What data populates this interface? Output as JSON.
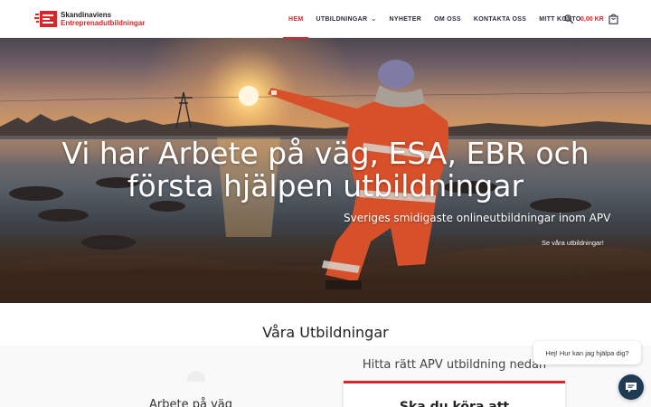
{
  "brand": {
    "line1": "Skandinaviens",
    "line2": "Entreprenadutbildningar",
    "accent": "#d8262b"
  },
  "nav": {
    "items": [
      {
        "label": "HEM",
        "active": true,
        "dropdown": false
      },
      {
        "label": "UTBILDNINGAR",
        "active": false,
        "dropdown": true
      },
      {
        "label": "NYHETER",
        "active": false,
        "dropdown": false
      },
      {
        "label": "OM OSS",
        "active": false,
        "dropdown": false
      },
      {
        "label": "KONTAKTA OSS",
        "active": false,
        "dropdown": false
      },
      {
        "label": "MITT KONTO",
        "active": false,
        "dropdown": false
      }
    ],
    "search_icon": "search-icon",
    "cart_total": "0,00 KR",
    "cart_icon": "shopping-bag-icon"
  },
  "hero": {
    "title": "Vi har Arbete på väg, ESA, EBR och första hjälpen utbildningar",
    "subtitle": "Sveriges smidigaste onlineutbildningar inom APV",
    "cta": "Se våra utbildningar!"
  },
  "main": {
    "section_title": "Våra Utbildningar",
    "find_title": "Hitta rätt APV utbildning nedan",
    "card_heading": "Ska du köra att",
    "left_partial": "Arbete på väg"
  },
  "chat": {
    "message": "Hej! Hur kan jag hjälpa dig?",
    "icon": "chat-icon",
    "color": "#1f3a52"
  }
}
